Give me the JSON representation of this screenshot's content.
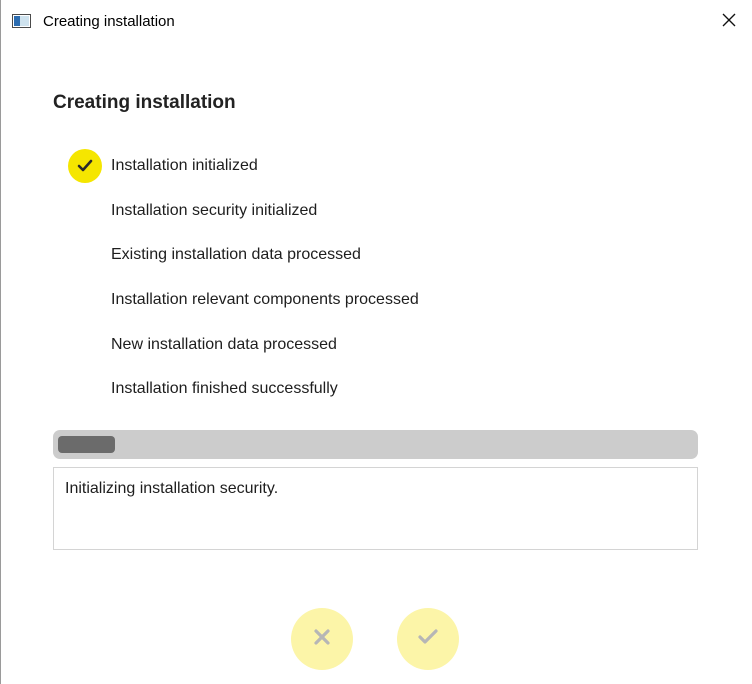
{
  "window": {
    "title": "Creating installation",
    "close_glyph": "✕",
    "app_icon": "app-window-icon",
    "close_icon": "close-icon"
  },
  "main": {
    "heading": "Creating installation",
    "steps": [
      {
        "label": "Installation initialized",
        "done": true
      },
      {
        "label": "Installation security initialized",
        "done": false
      },
      {
        "label": "Existing installation data processed",
        "done": false
      },
      {
        "label": "Installation relevant components processed",
        "done": false
      },
      {
        "label": "New installation data processed",
        "done": false
      },
      {
        "label": "Installation finished successfully",
        "done": false
      }
    ],
    "progress": 0.09,
    "log_text": "Initializing installation security."
  },
  "footer": {
    "cancel_icon": "cancel-x-icon",
    "confirm_icon": "confirm-check-icon"
  },
  "colors": {
    "accent_yellow": "#f5e600",
    "disabled_yellow": "#fcf5a8",
    "progress_track": "#cccccc",
    "progress_fill": "#6b6b6b"
  }
}
